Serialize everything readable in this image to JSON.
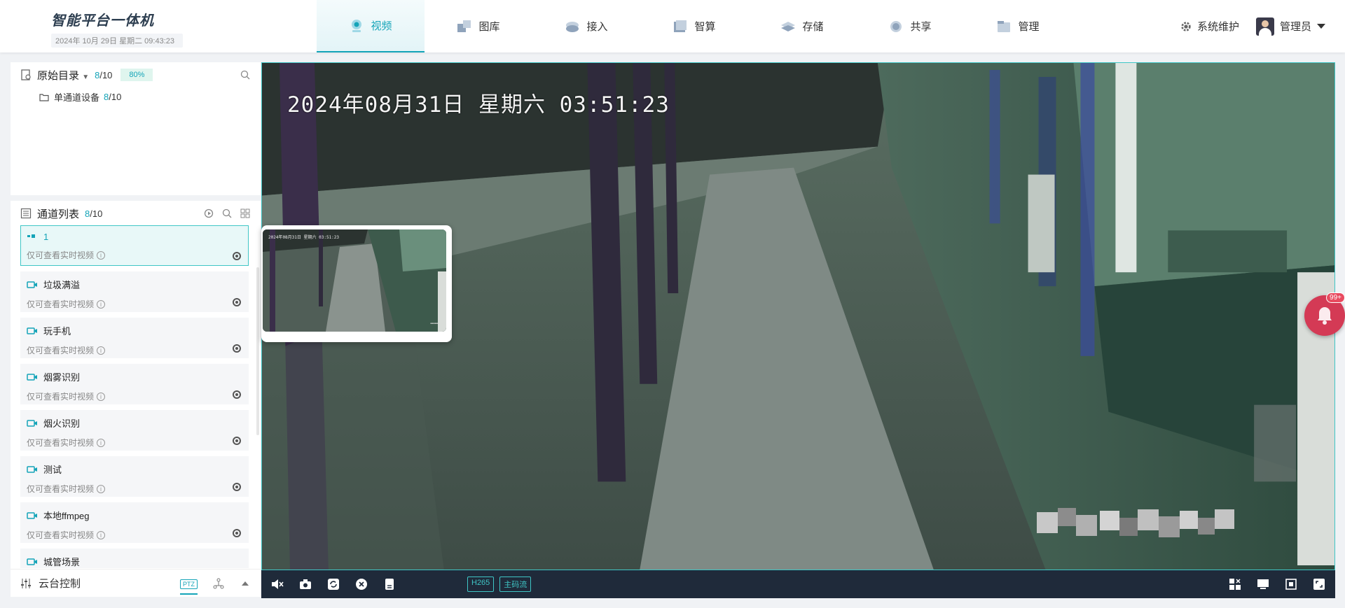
{
  "header": {
    "title": "智能平台一体机",
    "datetime": "2024年 10月 29日 星期二 09:43:23",
    "nav": [
      {
        "label": "视频",
        "icon": "video-globe-icon",
        "active": true
      },
      {
        "label": "图库",
        "icon": "gallery-icon",
        "active": false
      },
      {
        "label": "接入",
        "icon": "access-icon",
        "active": false
      },
      {
        "label": "智算",
        "icon": "compute-icon",
        "active": false
      },
      {
        "label": "存储",
        "icon": "storage-icon",
        "active": false
      },
      {
        "label": "共享",
        "icon": "share-icon",
        "active": false
      },
      {
        "label": "管理",
        "icon": "manage-icon",
        "active": false
      }
    ],
    "maintenance": "系统维护",
    "user": "管理员"
  },
  "left": {
    "catalog": {
      "title": "原始目录",
      "count_hl": "8",
      "count_total": "/10",
      "percent": "80%"
    },
    "tree": [
      {
        "label": "单通道设备",
        "count_hl": "8",
        "count_total": "/10"
      }
    ],
    "channel_list": {
      "title": "通道列表",
      "count_hl": "8",
      "count_total": "/10"
    },
    "channels": [
      {
        "name": "1",
        "status": "仅可查看实时视频",
        "selected": true
      },
      {
        "name": "垃圾满溢",
        "status": "仅可查看实时视频",
        "selected": false
      },
      {
        "name": "玩手机",
        "status": "仅可查看实时视频",
        "selected": false
      },
      {
        "name": "烟雾识别",
        "status": "仅可查看实时视频",
        "selected": false
      },
      {
        "name": "烟火识别",
        "status": "仅可查看实时视频",
        "selected": false
      },
      {
        "name": "测试",
        "status": "仅可查看实时视频",
        "selected": false
      },
      {
        "name": "本地ffmpeg",
        "status": "仅可查看实时视频",
        "selected": false
      },
      {
        "name": "城管场景",
        "status": "",
        "selected": false
      }
    ],
    "ptz": {
      "title": "云台控制",
      "tag": "PTZ"
    }
  },
  "video": {
    "osd": "2024年08月31日 星期六 03:51:23",
    "thumb_osd": "2024年08月31日 星期六 03:51:23",
    "codec": "H265",
    "stream": "主码流"
  },
  "notify": {
    "badge": "99+"
  },
  "colors": {
    "accent": "#14a4b8",
    "toolbar": "#1f2a3a",
    "bell": "#d43a55"
  }
}
